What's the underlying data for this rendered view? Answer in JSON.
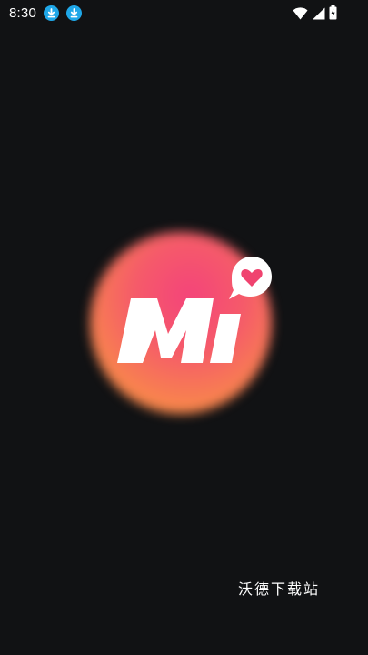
{
  "status_bar": {
    "time": "8:30",
    "notification_icons": [
      "download-icon",
      "download-icon"
    ],
    "system_icons": [
      "wifi-icon",
      "signal-icon",
      "battery-charging-icon"
    ]
  },
  "splash": {
    "logo_text": "Mi",
    "logo_icon": "heart-chat-bubble-icon",
    "colors": {
      "background": "#111214",
      "logo_gradient_start": "#f4447a",
      "logo_gradient_end": "#f99a3c",
      "heart": "#f0436f",
      "accent_download": "#1fa7e8"
    }
  },
  "watermark": {
    "text": "沃德下载站"
  }
}
